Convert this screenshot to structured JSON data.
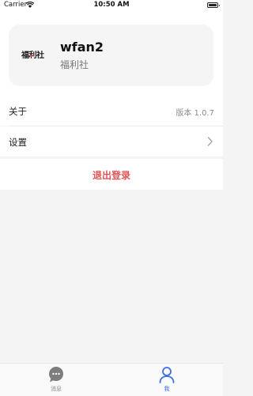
{
  "status_bar": {
    "carrier": "Carrier",
    "time": "10:50 AM"
  },
  "profile": {
    "logo_text": "福利社",
    "name": "wfan2",
    "subtitle": "福利社"
  },
  "rows": [
    {
      "label": "关于",
      "value": "版本 1.0.7"
    },
    {
      "label": "设置"
    }
  ],
  "logout_label": "退出登录",
  "tabs": [
    {
      "label": "消息",
      "icon": "chat-bubble-icon",
      "active": false
    },
    {
      "label": "我",
      "icon": "person-icon",
      "active": true
    }
  ],
  "colors": {
    "accent": "#3d6fe0",
    "logout": "#e25555",
    "inactive": "#8a8a8a"
  }
}
